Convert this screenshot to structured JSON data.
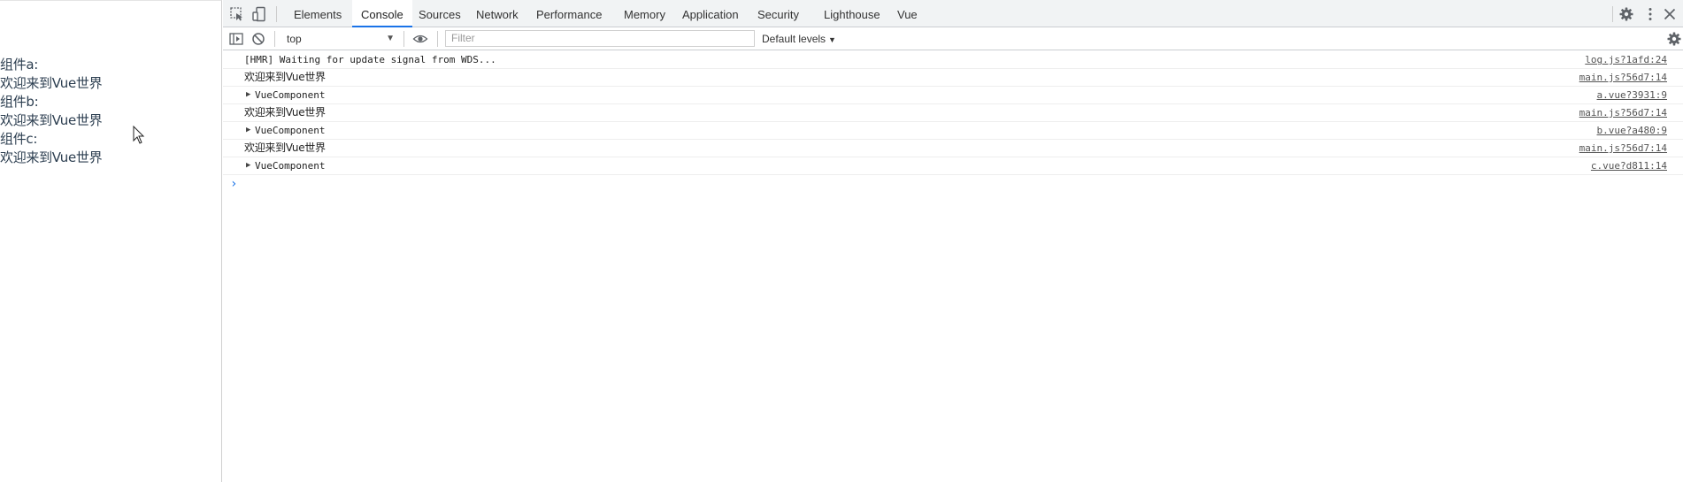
{
  "page": {
    "lines": [
      "组件a:",
      "欢迎来到Vue世界",
      "组件b:",
      "欢迎来到Vue世界",
      "组件c:",
      "欢迎来到Vue世界"
    ]
  },
  "devtools": {
    "tabs": [
      "Elements",
      "Console",
      "Sources",
      "Network",
      "Performance",
      "Memory",
      "Application",
      "Security",
      "Lighthouse",
      "Vue"
    ],
    "active_tab": "Console",
    "context": "top",
    "filter_placeholder": "Filter",
    "levels": "Default levels",
    "accent": "#1a73e8",
    "icons": [
      "inspect-element-icon",
      "device-toolbar-icon",
      "settings-gear-icon",
      "more-vertical-icon",
      "close-icon",
      "sidebar-toggle-icon",
      "clear-console-icon",
      "eye-icon",
      "console-settings-icon"
    ]
  },
  "console": {
    "rows": [
      {
        "text": "[HMR] Waiting for update signal from WDS...",
        "source": "log.js?1afd:24"
      },
      {
        "text": "欢迎来到Vue世界",
        "source": "main.js?56d7:14"
      },
      {
        "text": "VueComponent",
        "source": "a.vue?3931:9"
      },
      {
        "text": "欢迎来到Vue世界",
        "source": "main.js?56d7:14"
      },
      {
        "text": "VueComponent",
        "source": "b.vue?a480:9"
      },
      {
        "text": "欢迎来到Vue世界",
        "source": "main.js?56d7:14"
      },
      {
        "text": "VueComponent",
        "source": "c.vue?d811:14"
      }
    ],
    "prompt": "›"
  }
}
